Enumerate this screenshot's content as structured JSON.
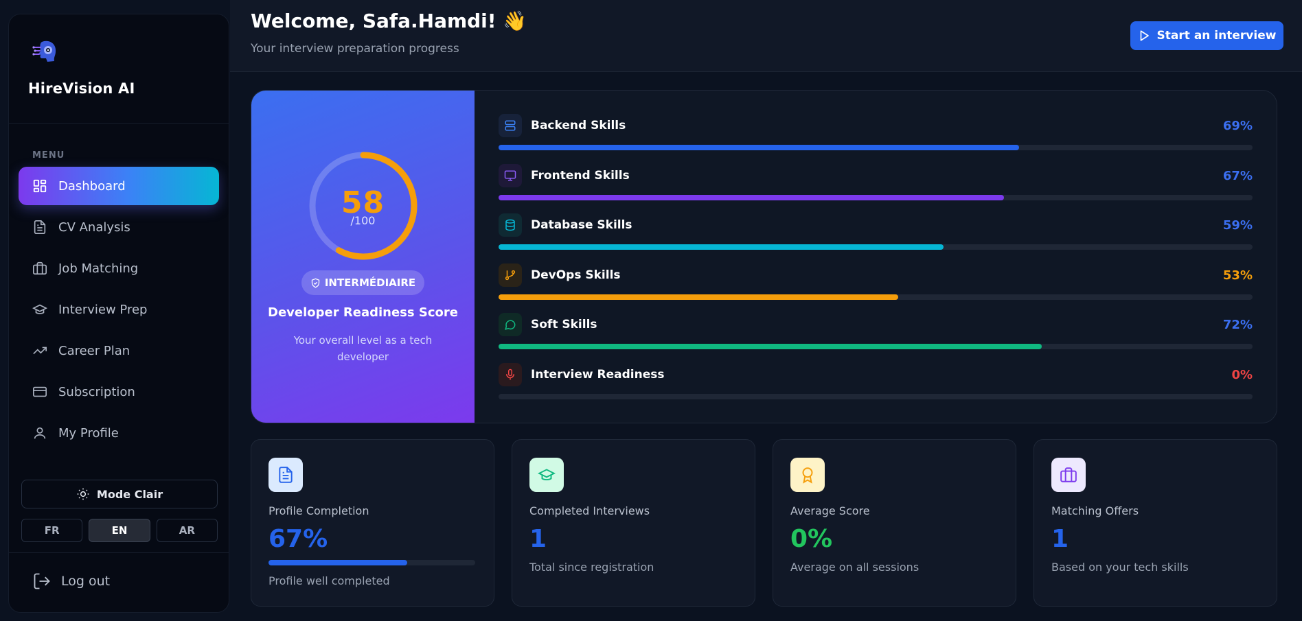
{
  "sidebar": {
    "brand": "HireVision AI",
    "menu_label": "MENU",
    "items": [
      {
        "label": "Dashboard",
        "icon": "dashboard-icon",
        "active": true
      },
      {
        "label": "CV Analysis",
        "icon": "document-icon"
      },
      {
        "label": "Job Matching",
        "icon": "briefcase-icon"
      },
      {
        "label": "Interview Prep",
        "icon": "graduation-cap-icon"
      },
      {
        "label": "Career Plan",
        "icon": "trending-up-icon"
      },
      {
        "label": "Subscription",
        "icon": "credit-card-icon"
      },
      {
        "label": "My Profile",
        "icon": "user-icon"
      }
    ],
    "mode_label": "Mode Clair",
    "languages": [
      "FR",
      "EN",
      "AR"
    ],
    "active_language": "EN",
    "logout_label": "Log out"
  },
  "header": {
    "welcome": "Welcome, Safa.Hamdi! 👋",
    "subtitle": "Your interview preparation progress",
    "start_button": "Start an interview"
  },
  "score": {
    "value": "58",
    "max": "/100",
    "fraction": 0.58,
    "level": "INTERMÉDIAIRE",
    "title": "Developer Readiness Score",
    "description": "Your overall level as a tech developer"
  },
  "skills": [
    {
      "name": "Backend Skills",
      "percent": "69%",
      "value": 69,
      "color": "#2563eb",
      "pct_color": "#3b6ff0",
      "icon": "server-icon",
      "icon_bg": "#17223a"
    },
    {
      "name": "Frontend Skills",
      "percent": "67%",
      "value": 67,
      "color": "#7c3aed",
      "pct_color": "#3b6ff0",
      "icon": "monitor-icon",
      "icon_bg": "#1e1938"
    },
    {
      "name": "Database Skills",
      "percent": "59%",
      "value": 59,
      "color": "#06b6d4",
      "pct_color": "#3b6ff0",
      "icon": "database-icon",
      "icon_bg": "#0f2a33"
    },
    {
      "name": "DevOps Skills",
      "percent": "53%",
      "value": 53,
      "color": "#f59e0b",
      "pct_color": "#f59e0b",
      "icon": "git-branch-icon",
      "icon_bg": "#2a2318"
    },
    {
      "name": "Soft Skills",
      "percent": "72%",
      "value": 72,
      "color": "#10b981",
      "pct_color": "#3b6ff0",
      "icon": "chat-bubble-icon",
      "icon_bg": "#0f2a26"
    },
    {
      "name": "Interview Readiness",
      "percent": "0%",
      "value": 0,
      "color": "#ef4444",
      "pct_color": "#ef4444",
      "icon": "microphone-icon",
      "icon_bg": "#2a1a1e"
    }
  ],
  "stats": [
    {
      "label": "Profile Completion",
      "value": "67%",
      "progress": 67,
      "sub": "Profile well completed",
      "value_color": "#2563eb",
      "icon": "document-icon",
      "icon_bg": "#dbeafe",
      "icon_color": "#2563eb"
    },
    {
      "label": "Completed Interviews",
      "value": "1",
      "sub": "Total since registration",
      "value_color": "#2563eb",
      "icon": "graduation-cap-icon",
      "icon_bg": "#d1fae5",
      "icon_color": "#10b981"
    },
    {
      "label": "Average Score",
      "value": "0%",
      "sub": "Average on all sessions",
      "value_color": "#22c55e",
      "icon": "award-icon",
      "icon_bg": "#fef3c7",
      "icon_color": "#f59e0b"
    },
    {
      "label": "Matching Offers",
      "value": "1",
      "sub": "Based on your tech skills",
      "value_color": "#2563eb",
      "icon": "briefcase-icon",
      "icon_bg": "#ede9fe",
      "icon_color": "#7c3aed"
    }
  ]
}
